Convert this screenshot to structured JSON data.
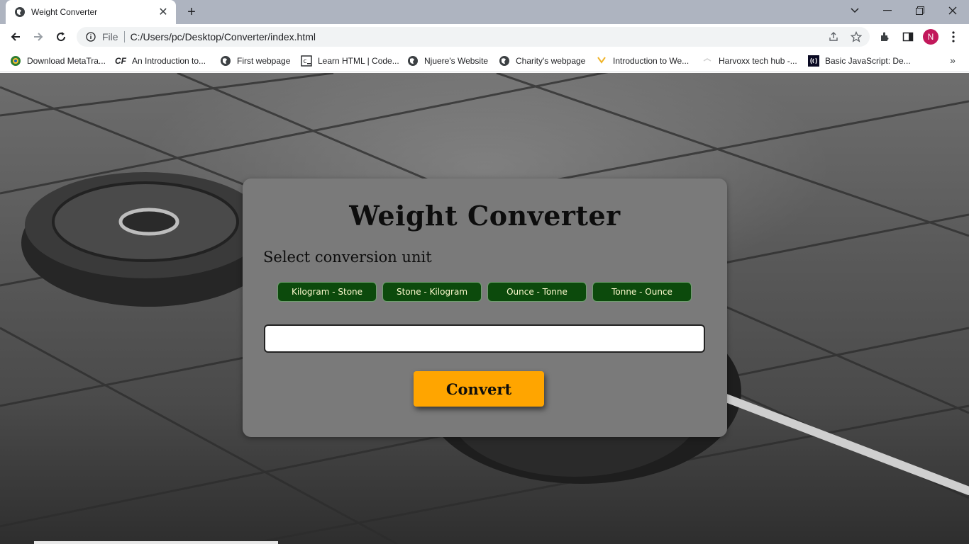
{
  "browser": {
    "tab_title": "Weight Converter",
    "url_scheme": "File",
    "url": "C:/Users/pc/Desktop/Converter/index.html",
    "profile_initial": "N",
    "bookmarks": [
      {
        "label": "Download MetaTra...",
        "icon": "metatrader-icon"
      },
      {
        "label": "An Introduction to...",
        "icon": "cf-icon"
      },
      {
        "label": "First webpage",
        "icon": "globe-icon"
      },
      {
        "label": "Learn HTML | Code...",
        "icon": "codecademy-icon"
      },
      {
        "label": "Njuere's Website",
        "icon": "globe-icon"
      },
      {
        "label": "Charity's webpage",
        "icon": "globe-icon"
      },
      {
        "label": "Introduction to We...",
        "icon": "bookmark-icon"
      },
      {
        "label": "Harvoxx tech hub -...",
        "icon": "bookmark-icon"
      },
      {
        "label": "Basic JavaScript: De...",
        "icon": "freecodecamp-icon"
      }
    ]
  },
  "page": {
    "title": "Weight Converter",
    "subtitle": "Select conversion unit",
    "unit_buttons": [
      "Kilogram - Stone",
      "Stone - Kilogram",
      "Ounce - Tonne",
      "Tonne - Ounce"
    ],
    "input_value": "",
    "input_placeholder": "",
    "convert_label": "Convert"
  },
  "colors": {
    "card": "#7a7a7a",
    "unit_button": "#0c4a0c",
    "convert_button": "#ffa500",
    "profile": "#c2185b"
  }
}
